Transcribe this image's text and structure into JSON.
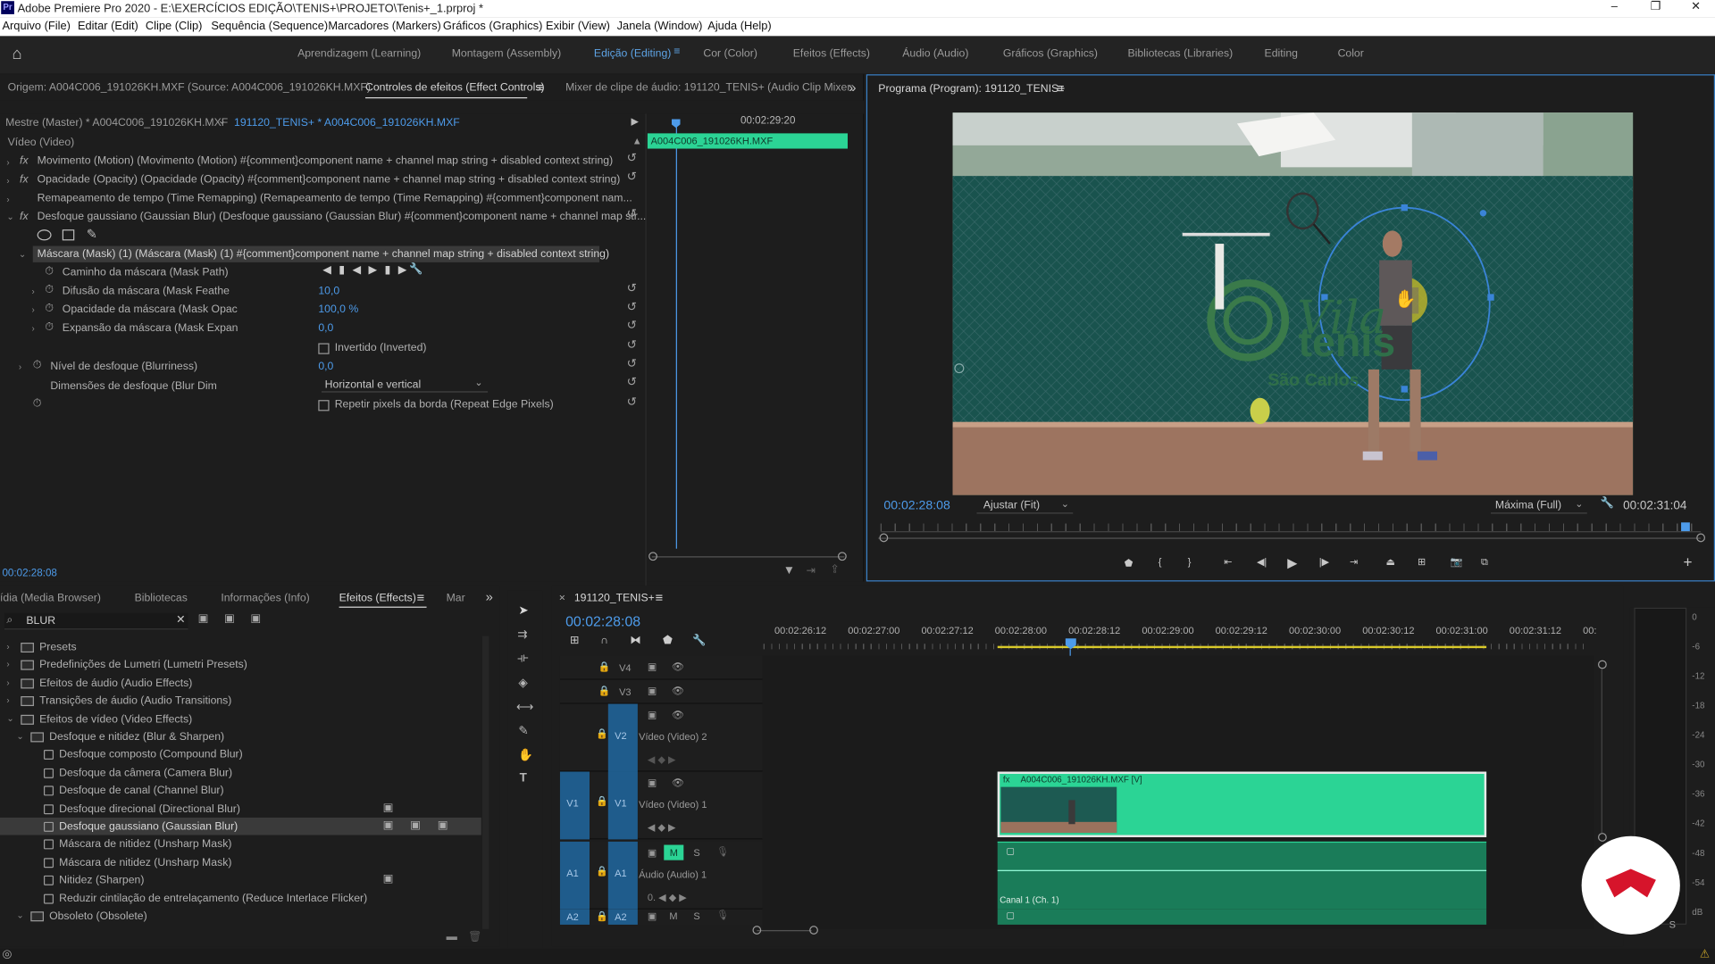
{
  "title_bar": {
    "app_icon": "Pr",
    "title": "Adobe Premiere Pro 2020 - E:\\EXERCÍCIOS EDIÇÃO\\TENIS+\\PROJETO\\Tenis+_1.prproj *",
    "minimize": "–",
    "maximize": "❐",
    "close": "✕"
  },
  "menu": [
    "Arquivo (File)",
    "Editar (Edit)",
    "Clipe (Clip)",
    "Sequência (Sequence)",
    "Marcadores (Markers)",
    "Gráficos (Graphics)",
    "Exibir (View)",
    "Janela (Window)",
    "Ajuda (Help)"
  ],
  "workspaces": [
    "Aprendizagem (Learning)",
    "Montagem (Assembly)",
    "Edição (Editing)",
    "Cor (Color)",
    "Efeitos (Effects)",
    "Áudio (Audio)",
    "Gráficos (Graphics)",
    "Bibliotecas (Libraries)",
    "Editing",
    "Color"
  ],
  "active_workspace": "Edição (Editing)",
  "source_tabs": {
    "origin": "Origem: A004C006_191026KH.MXF (Source: A004C006_191026KH.MXF)",
    "effect_controls": "Controles de efeitos (Effect Controls)",
    "mixer": "Mixer de clipe de áudio: 191120_TENIS+ (Audio Clip Mixer:"
  },
  "effect_controls": {
    "master": "Mestre (Master) * A004C006_191026KH.MXF",
    "sequence_clip": "191120_TENIS+ * A004C006_191026KH.MXF",
    "mini_time": "00:02:29:20",
    "mini_clip": "A004C006_191026KH.MXF",
    "section": "Vídeo (Video)",
    "rows": [
      "Movimento (Motion)   (Movimento (Motion)  #{comment}component name + channel map string + disabled context string)",
      "Opacidade (Opacity)   (Opacidade (Opacity)  #{comment}component name + channel map string + disabled context string)",
      "Remapeamento de tempo (Time Remapping)   (Remapeamento de tempo (Time Remapping)  #{comment}component nam...",
      "Desfoque gaussiano (Gaussian Blur)   (Desfoque gaussiano (Gaussian Blur)  #{comment}component name + channel map str..."
    ],
    "mask_row": "Máscara (Mask) (1)   (Máscara (Mask) (1)  #{comment}component name + channel map string + disabled context string)",
    "mask_path": "Caminho da máscara (Mask Path)",
    "mask_feather": {
      "label": "Difusão da máscara (Mask Feathe",
      "value": "10,0"
    },
    "mask_opacity": {
      "label": "Opacidade da máscara (Mask Opac",
      "value": "100,0 %"
    },
    "mask_expansion": {
      "label": "Expansão da máscara (Mask Expan",
      "value": "0,0"
    },
    "inverted": "Invertido (Inverted)",
    "blurriness": {
      "label": "Nível de desfoque (Blurriness)",
      "value": "0,0"
    },
    "blur_dim": {
      "label": "Dimensões de desfoque (Blur Dim",
      "value": "Horizontal e vertical"
    },
    "repeat_edge": "Repetir pixels da borda (Repeat Edge Pixels)",
    "timecode": "00:02:28:08"
  },
  "program": {
    "title": "Programa (Program): 191120_TENIS+",
    "timecode": "00:02:28:08",
    "fit": "Ajustar (Fit)",
    "quality": "Máxima (Full)",
    "duration": "00:02:31:04",
    "logo_text_1": "Vila",
    "logo_text_2": "tenis",
    "logo_text_3": "São Carlos"
  },
  "effects_panel": {
    "tabs": [
      "ídia (Media Browser)",
      "Bibliotecas",
      "Informações (Info)",
      "Efeitos (Effects)",
      "Mar"
    ],
    "search": "BLUR",
    "tree": [
      {
        "label": "Presets",
        "level": 0,
        "folder": true
      },
      {
        "label": "Predefinições de Lumetri (Lumetri Presets)",
        "level": 0,
        "folder": true
      },
      {
        "label": "Efeitos de áudio (Audio Effects)",
        "level": 0,
        "folder": true
      },
      {
        "label": "Transições de áudio (Audio Transitions)",
        "level": 0,
        "folder": true
      },
      {
        "label": "Efeitos de vídeo (Video Effects)",
        "level": 0,
        "folder": true
      },
      {
        "label": "Desfoque e nitidez (Blur & Sharpen)",
        "level": 1,
        "folder": true
      },
      {
        "label": "Desfoque composto (Compound Blur)",
        "level": 2
      },
      {
        "label": "Desfoque da câmera (Camera Blur)",
        "level": 2
      },
      {
        "label": "Desfoque de canal (Channel Blur)",
        "level": 2
      },
      {
        "label": "Desfoque direcional (Directional Blur)",
        "level": 2
      },
      {
        "label": "Desfoque gaussiano (Gaussian Blur)",
        "level": 2
      },
      {
        "label": "Máscara de nitidez (Unsharp Mask)",
        "level": 2
      },
      {
        "label": "Máscara de nitidez (Unsharp Mask)",
        "level": 2
      },
      {
        "label": "Nitidez (Sharpen)",
        "level": 2
      },
      {
        "label": "Reduzir cintilação de entrelaçamento (Reduce Interlace Flicker)",
        "level": 2
      },
      {
        "label": "Obsoleto (Obsolete)",
        "level": 1,
        "folder": true
      }
    ]
  },
  "timeline": {
    "sequence": "191120_TENIS+",
    "timecode": "00:02:28:08",
    "ruler": [
      "00:02:26:12",
      "00:02:27:00",
      "00:02:27:12",
      "00:02:28:00",
      "00:02:28:12",
      "00:02:29:00",
      "00:02:29:12",
      "00:02:30:00",
      "00:02:30:12",
      "00:02:31:00",
      "00:02:31:12",
      "00:"
    ],
    "tracks": {
      "v4": "V4",
      "v3": "V3",
      "v2": "V2",
      "v2_name": "Vídeo (Video) 2",
      "v1": "V1",
      "v1_name": "Vídeo (Video) 1",
      "a1": "A1",
      "a1_name": "Áudio (Audio) 1",
      "a2": "A2"
    },
    "video_clip": "A004C006_191026KH.MXF [V]",
    "audio_clip": "Canal 1 (Ch. 1)",
    "m": "M",
    "s": "S"
  },
  "meter": [
    "0",
    "-6",
    "-12",
    "-18",
    "-24",
    "-30",
    "-36",
    "-42",
    "-48",
    "-54",
    "dB"
  ],
  "colors": {
    "accent": "#4d9bea",
    "clip_green": "#2bd495",
    "audio_green": "#1a7c59",
    "logo_red": "#d6142b"
  }
}
